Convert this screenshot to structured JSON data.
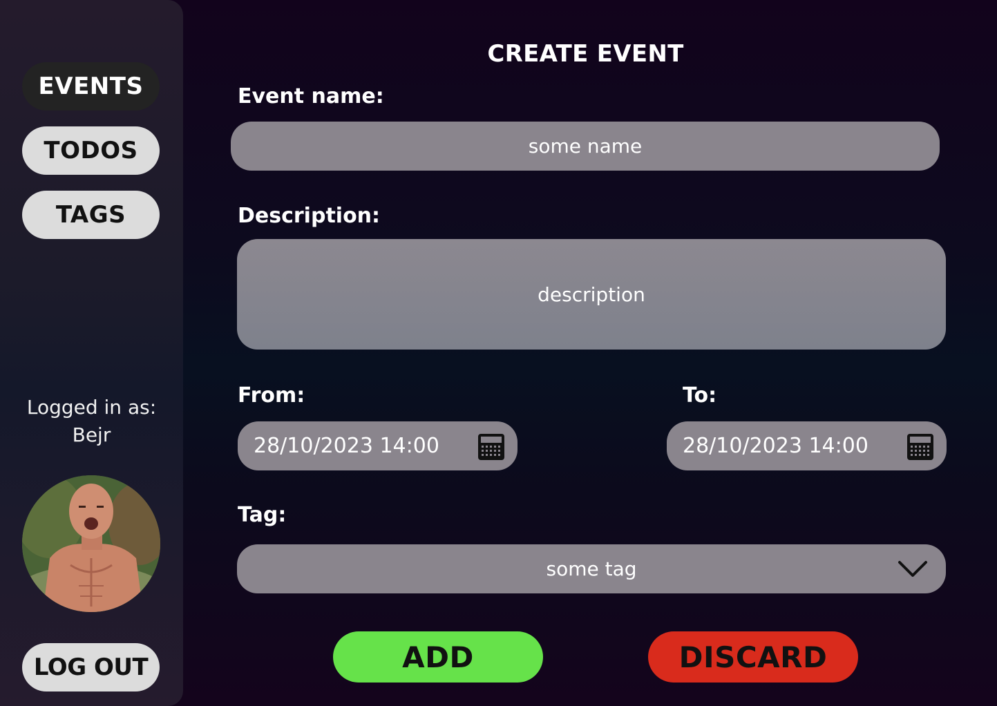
{
  "sidebar": {
    "nav": [
      {
        "label": "EVENTS",
        "active": true
      },
      {
        "label": "TODOS",
        "active": false
      },
      {
        "label": "TAGS",
        "active": false
      }
    ],
    "logged_in_label": "Logged in as:",
    "username": "Bejr",
    "logout_label": "LOG OUT"
  },
  "form": {
    "title": "CREATE EVENT",
    "event_name_label": "Event name:",
    "event_name_value": "some name",
    "description_label": "Description:",
    "description_value": "description",
    "from_label": "From:",
    "from_value": "28/10/2023 14:00",
    "to_label": "To:",
    "to_value": "28/10/2023 14:00",
    "tag_label": "Tag:",
    "tag_value": "some tag",
    "add_label": "ADD",
    "discard_label": "DISCARD"
  },
  "colors": {
    "add": "#66e24a",
    "discard": "#d92b1c",
    "field": "#8a858d",
    "active_nav": "#232323",
    "inactive_nav": "#dcdcdc"
  }
}
